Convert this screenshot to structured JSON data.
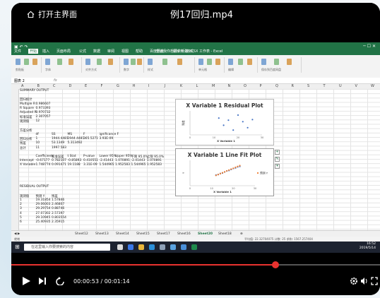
{
  "player": {
    "home_label": "打开主界面",
    "video_title": "例17回归.mp4",
    "current_time": "00:00:53",
    "total_time": "00:01:14",
    "time_separator": " / ",
    "progress": 0.716
  },
  "excel": {
    "window_title": "新建 XLSX 工作表 - Excel",
    "ribbon_tabs": [
      "文件",
      "开始",
      "插入",
      "页面布局",
      "公式",
      "数据",
      "审阅",
      "视图",
      "帮助",
      "百度网盘",
      "设计",
      "格式"
    ],
    "tell_me": "告诉我你想要做什么",
    "ribbon_groups": [
      "剪贴板",
      "字体",
      "对齐方式",
      "数字",
      "样式",
      "单元格",
      "编辑",
      "保存到百度网盘"
    ],
    "name_box": "图表 2",
    "formula_fx": "fx",
    "columns": [
      "A",
      "B",
      "C",
      "D",
      "E",
      "F",
      "G",
      "H",
      "I",
      "J",
      "K",
      "L",
      "M",
      "N",
      "O",
      "P",
      "Q",
      "R",
      "S",
      "T",
      "U",
      "V",
      "W"
    ],
    "summary": {
      "title": "SUMMARY OUTPUT",
      "regression_header": "回归统计",
      "stats": [
        {
          "label": "Multiple R",
          "value": "0.986607"
        },
        {
          "label": "R Square",
          "value": "0.973393"
        },
        {
          "label": "Adjusted R",
          "value": "0.970732"
        },
        {
          "label": "标准误差",
          "value": "2.307057"
        },
        {
          "label": "观测值",
          "value": "12"
        }
      ],
      "anova_title": "方差分析",
      "anova_headers": [
        "",
        "df",
        "SS",
        "MS",
        "F",
        "ignificance F"
      ],
      "anova_rows": [
        [
          "回归分析",
          "1",
          "1944.4481",
          "1944.4481",
          "365.5271",
          "3.93E-09"
        ],
        [
          "残差",
          "10",
          "53.1349",
          "5.313492",
          ""
        ],
        [
          "总计",
          "11",
          "1997.583",
          "",
          ""
        ]
      ],
      "coef_headers": [
        "",
        "Coefficients",
        "标准误差",
        "t Stat",
        "P-value",
        "Lower 95%",
        "Upper 95%",
        "下限 95.0%",
        "上限 95.0%"
      ],
      "coef_rows": [
        [
          "Intercept",
          "-0.67177",
          "0.782107",
          "-0.85893",
          "0.410551",
          "-2.41443",
          "1.070891",
          "-2.41443",
          "1.070891"
        ],
        [
          "X Variable",
          "1.748774",
          "0.091471",
          "19.1188",
          "3.31E-09",
          "1.544965",
          "1.952583",
          "1.544965",
          "1.952583"
        ]
      ],
      "residual_title": "RESIDUAL OUTPUT",
      "residual_headers": [
        "观测值",
        "预测 Y",
        "残差"
      ],
      "residual_rows": [
        [
          "1",
          "19.31854",
          "1.57846"
        ],
        [
          "2",
          "29.06003",
          "2.46807"
        ],
        [
          "3",
          "29.29754",
          "0.88746"
        ],
        [
          "4",
          "27.07302",
          "2.57397"
        ],
        [
          "5",
          "29.10945",
          "0.803554"
        ],
        [
          "6",
          "25.40935",
          "2.35915"
        ]
      ]
    },
    "residual_chart": {
      "title": "X Variable 1 Residual Plot",
      "ylabel": "残差",
      "xlabel": "X Variable 1"
    },
    "fit_chart": {
      "title": "X Variable 1 Line Fit  Plot",
      "ylabel": "Y",
      "xlabel": "X Variable 1",
      "legend": "预测 Y"
    },
    "sheet_tabs": [
      "Sheet12",
      "Sheet13",
      "Sheet14",
      "Sheet15",
      "Sheet17",
      "Sheet16",
      "Sheet20",
      "Sheet18"
    ],
    "active_sheet": "Sheet20",
    "status_left": "就绪",
    "status_stats": "平均值: 22.32704075   计数: 25   求和: 1567.257404",
    "taskbar_search": "在这里输入你要搜索的内容",
    "taskbar_time": "16:52",
    "taskbar_date": "2019/5/14"
  },
  "chart_data": [
    {
      "type": "scatter",
      "title": "X Variable 1 Residual Plot",
      "xlabel": "X Variable 1",
      "ylabel": "残差",
      "xlim": [
        0,
        30
      ],
      "series": [
        {
          "x": [
            12,
            14,
            16,
            18,
            20,
            22,
            24,
            26
          ],
          "y": [
            1.6,
            -0.8,
            0.9,
            -2.4,
            2.6,
            0.4,
            -1.6,
            1.1
          ]
        }
      ]
    },
    {
      "type": "scatter",
      "title": "X Variable 1 Line Fit  Plot",
      "xlabel": "X Variable 1",
      "ylabel": "Y",
      "xlim": [
        0,
        30
      ],
      "ylim": [
        0,
        50
      ],
      "series": [
        {
          "name": "Y",
          "x": [
            12,
            13,
            14,
            15,
            16,
            17,
            18,
            19,
            20,
            21,
            22,
            23
          ],
          "y": [
            21,
            22,
            24,
            25,
            27,
            29,
            30,
            32,
            34,
            35,
            37,
            38
          ]
        },
        {
          "name": "预测 Y",
          "x": [
            12,
            13,
            14,
            15,
            16,
            17,
            18,
            19,
            20,
            21,
            22,
            23
          ],
          "y": [
            20.3,
            22.1,
            23.8,
            25.6,
            27.3,
            29.1,
            30.8,
            32.6,
            34.3,
            36.1,
            37.8,
            39.6
          ]
        }
      ]
    }
  ],
  "colors": {
    "excel_green": "#217346",
    "progress": "#e8322f",
    "taskbar": "#1d2330"
  }
}
